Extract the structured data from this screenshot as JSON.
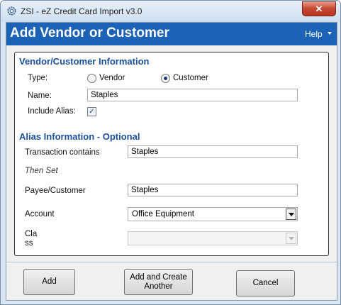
{
  "window": {
    "title": "ZSI - eZ Credit Card Import v3.0",
    "close_glyph": "✕",
    "app_icon": "gear-icon"
  },
  "header": {
    "title": "Add Vendor or Customer",
    "help_label": "Help"
  },
  "vendor_section": {
    "title": "Vendor/Customer Information",
    "type_label": "Type:",
    "type_options": [
      "Vendor",
      "Customer"
    ],
    "type_selected": "Customer",
    "name_label": "Name:",
    "name_value": "Staples",
    "include_alias_label": "Include Alias:",
    "include_alias_checked": true,
    "check_glyph": "✓"
  },
  "alias_section": {
    "title": "Alias Information - Optional",
    "transaction_label": "Transaction contains",
    "transaction_value": "Staples",
    "then_set_label": "Then Set",
    "payee_label": "Payee/Customer",
    "payee_value": "Staples",
    "account_label": "Account",
    "account_value": "Office Equipment",
    "class_label_line1": "Cla",
    "class_label_line2": "ss",
    "class_value": ""
  },
  "buttons": {
    "add": "Add",
    "add_create_line1": "Add and Create",
    "add_create_line2": "Another",
    "cancel": "Cancel"
  },
  "colors": {
    "header_bg": "#1c63b7",
    "section_title": "#1a4f99",
    "close_button": "#c74a34"
  }
}
